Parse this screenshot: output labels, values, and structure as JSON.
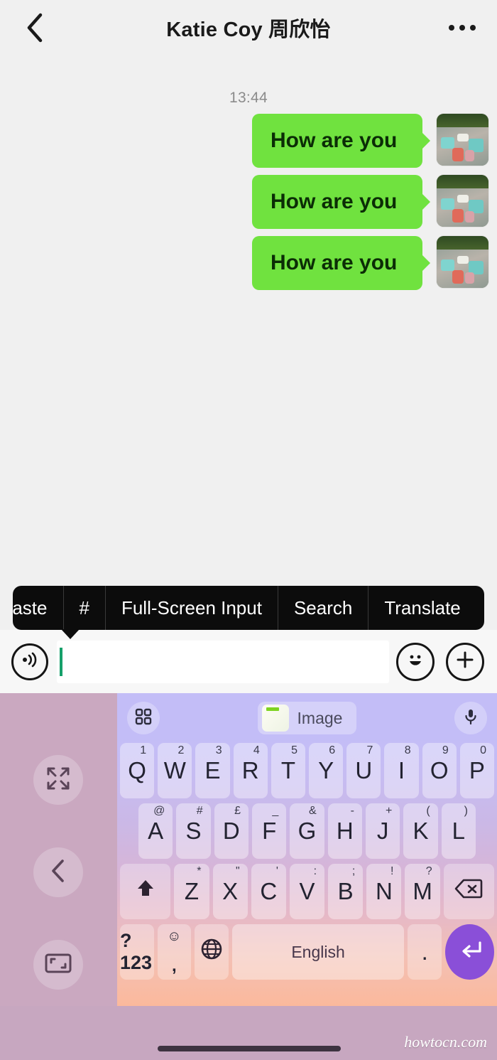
{
  "header": {
    "title": "Katie Coy 周欣怡",
    "back_icon": "chevron-left-icon",
    "more_icon": "more-horizontal-icon"
  },
  "chat": {
    "timestamp": "13:44",
    "messages": [
      {
        "text": "How are you",
        "side": "outgoing"
      },
      {
        "text": "How are you",
        "side": "outgoing"
      },
      {
        "text": "How are you",
        "side": "outgoing"
      }
    ],
    "bubble_color": "#70e23f",
    "background": "#f0f0f0"
  },
  "context_menu": {
    "items": [
      {
        "label": "Paste",
        "clipped": true
      },
      {
        "label": "#",
        "clipped": false
      },
      {
        "label": "Full-Screen Input",
        "clipped": false
      },
      {
        "label": "Search",
        "clipped": false
      },
      {
        "label": "Translate",
        "clipped": false
      }
    ],
    "background": "#0c0c0c"
  },
  "input_bar": {
    "voice_icon": "voice-wave-icon",
    "value": "",
    "placeholder": "",
    "emoji_icon": "smiley-face-icon",
    "add_icon": "plus-circle-icon",
    "caret_color": "#16a06a"
  },
  "keyboard": {
    "toolbar": {
      "grid_icon": "grid-apps-icon",
      "suggestion_label": "Image",
      "suggestion_thumb_icon": "image-thumbnail-icon",
      "mic_icon": "microphone-icon"
    },
    "row1": [
      {
        "key": "Q",
        "sup": "1"
      },
      {
        "key": "W",
        "sup": "2"
      },
      {
        "key": "E",
        "sup": "3"
      },
      {
        "key": "R",
        "sup": "4"
      },
      {
        "key": "T",
        "sup": "5"
      },
      {
        "key": "Y",
        "sup": "6"
      },
      {
        "key": "U",
        "sup": "7"
      },
      {
        "key": "I",
        "sup": "8"
      },
      {
        "key": "O",
        "sup": "9"
      },
      {
        "key": "P",
        "sup": "0"
      }
    ],
    "row2": [
      {
        "key": "A",
        "sup": "@"
      },
      {
        "key": "S",
        "sup": "#"
      },
      {
        "key": "D",
        "sup": "£"
      },
      {
        "key": "F",
        "sup": "_"
      },
      {
        "key": "G",
        "sup": "&"
      },
      {
        "key": "H",
        "sup": "-"
      },
      {
        "key": "J",
        "sup": "+"
      },
      {
        "key": "K",
        "sup": "("
      },
      {
        "key": "L",
        "sup": ")"
      }
    ],
    "row3": {
      "shift_icon": "shift-arrow-icon",
      "keys": [
        {
          "key": "Z",
          "sup": "*"
        },
        {
          "key": "X",
          "sup": "\""
        },
        {
          "key": "C",
          "sup": "'"
        },
        {
          "key": "V",
          "sup": ":"
        },
        {
          "key": "B",
          "sup": ";"
        },
        {
          "key": "N",
          "sup": "!"
        },
        {
          "key": "M",
          "sup": "?"
        }
      ],
      "backspace_icon": "backspace-icon"
    },
    "row4": {
      "symbols_label": "?123",
      "emoji_label": "☺",
      "comma_label": ",",
      "globe_icon": "globe-language-icon",
      "space_label": "English",
      "period_label": ".",
      "enter_icon": "enter-return-icon",
      "enter_color": "#8a4fd8"
    }
  },
  "side_buttons": [
    {
      "icon": "expand-arrows-icon",
      "name": "resize-keyboard-button"
    },
    {
      "icon": "chevron-left-icon",
      "name": "collapse-keyboard-button"
    },
    {
      "icon": "float-window-icon",
      "name": "float-keyboard-button"
    }
  ],
  "bottom": {
    "home_indicator": "home-indicator",
    "watermark": "howtocn.com"
  }
}
